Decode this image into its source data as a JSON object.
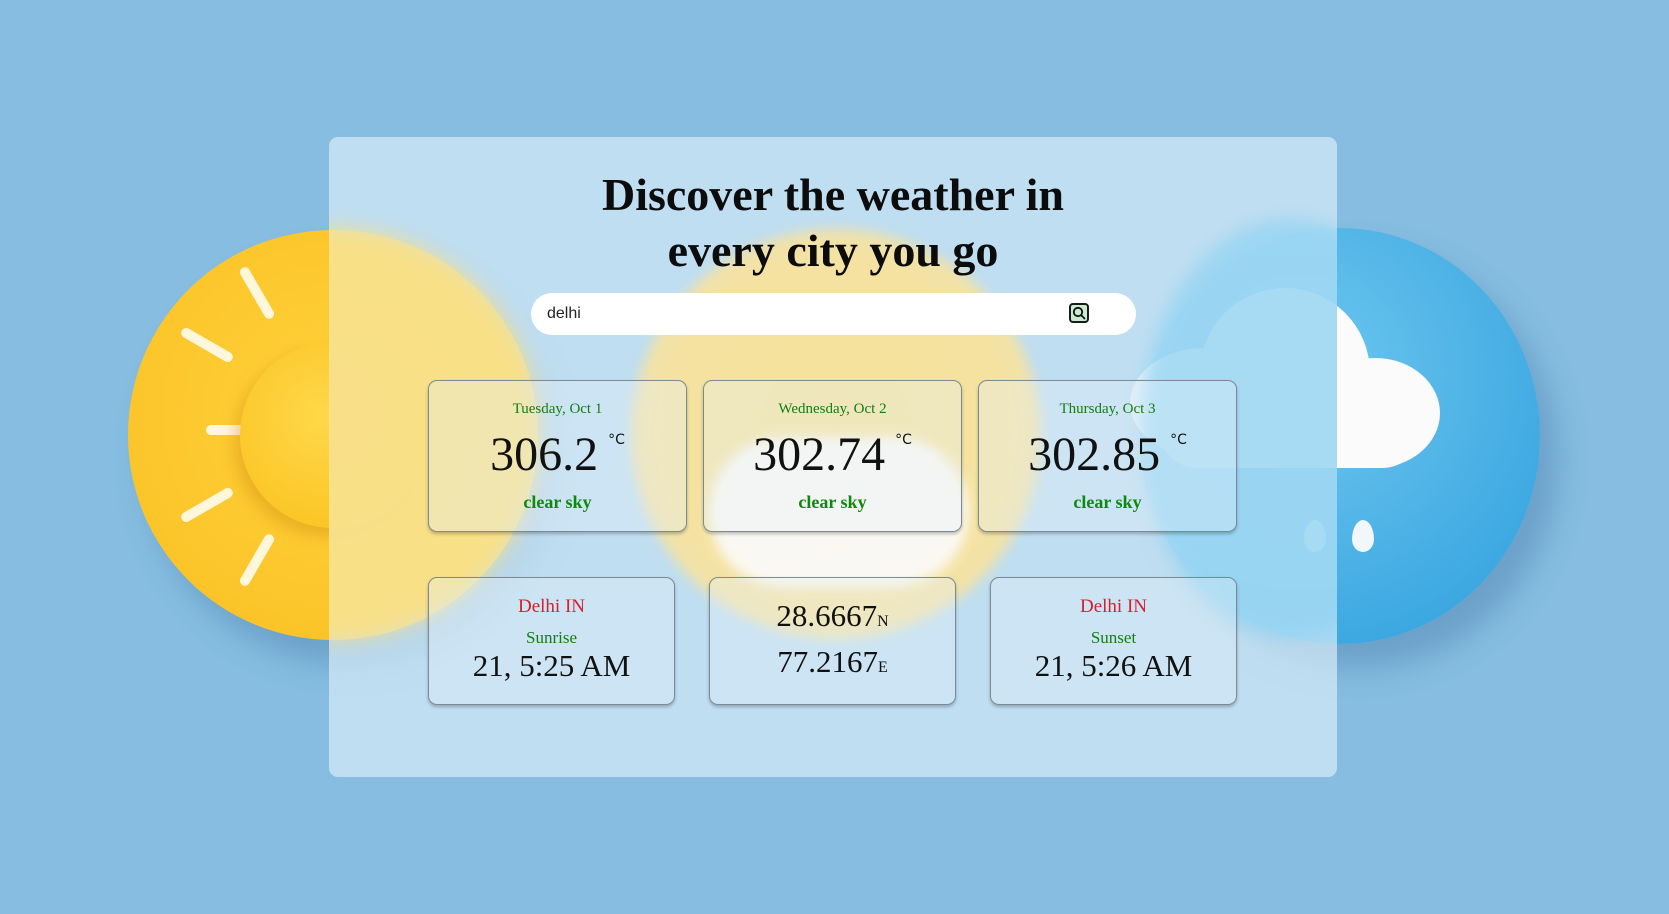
{
  "header": {
    "title_line1": "Discover the weather in",
    "title_line2": "every city you go"
  },
  "search": {
    "value": "delhi",
    "button_icon": "search-icon"
  },
  "forecast": [
    {
      "date": "Tuesday, Oct 1",
      "temp": "306.2",
      "unit": "°C",
      "desc": "clear sky"
    },
    {
      "date": "Wednesday, Oct 2",
      "temp": "302.74",
      "unit": "°C",
      "desc": "clear sky"
    },
    {
      "date": "Thursday, Oct 3",
      "temp": "302.85",
      "unit": "°C",
      "desc": "clear sky"
    }
  ],
  "sunrise": {
    "city": "Delhi IN",
    "label": "Sunrise",
    "time": "21, 5:25 AM"
  },
  "coords": {
    "lat": "28.6667",
    "lat_dir": "N",
    "lon": "77.2167",
    "lon_dir": "E"
  },
  "sunset": {
    "city": "Delhi IN",
    "label": "Sunset",
    "time": "21, 5:26 AM"
  },
  "colors": {
    "background": "#86bde0",
    "date_green": "#137e13",
    "desc_green": "#0c8a0c",
    "city_red": "#d81e2b"
  }
}
